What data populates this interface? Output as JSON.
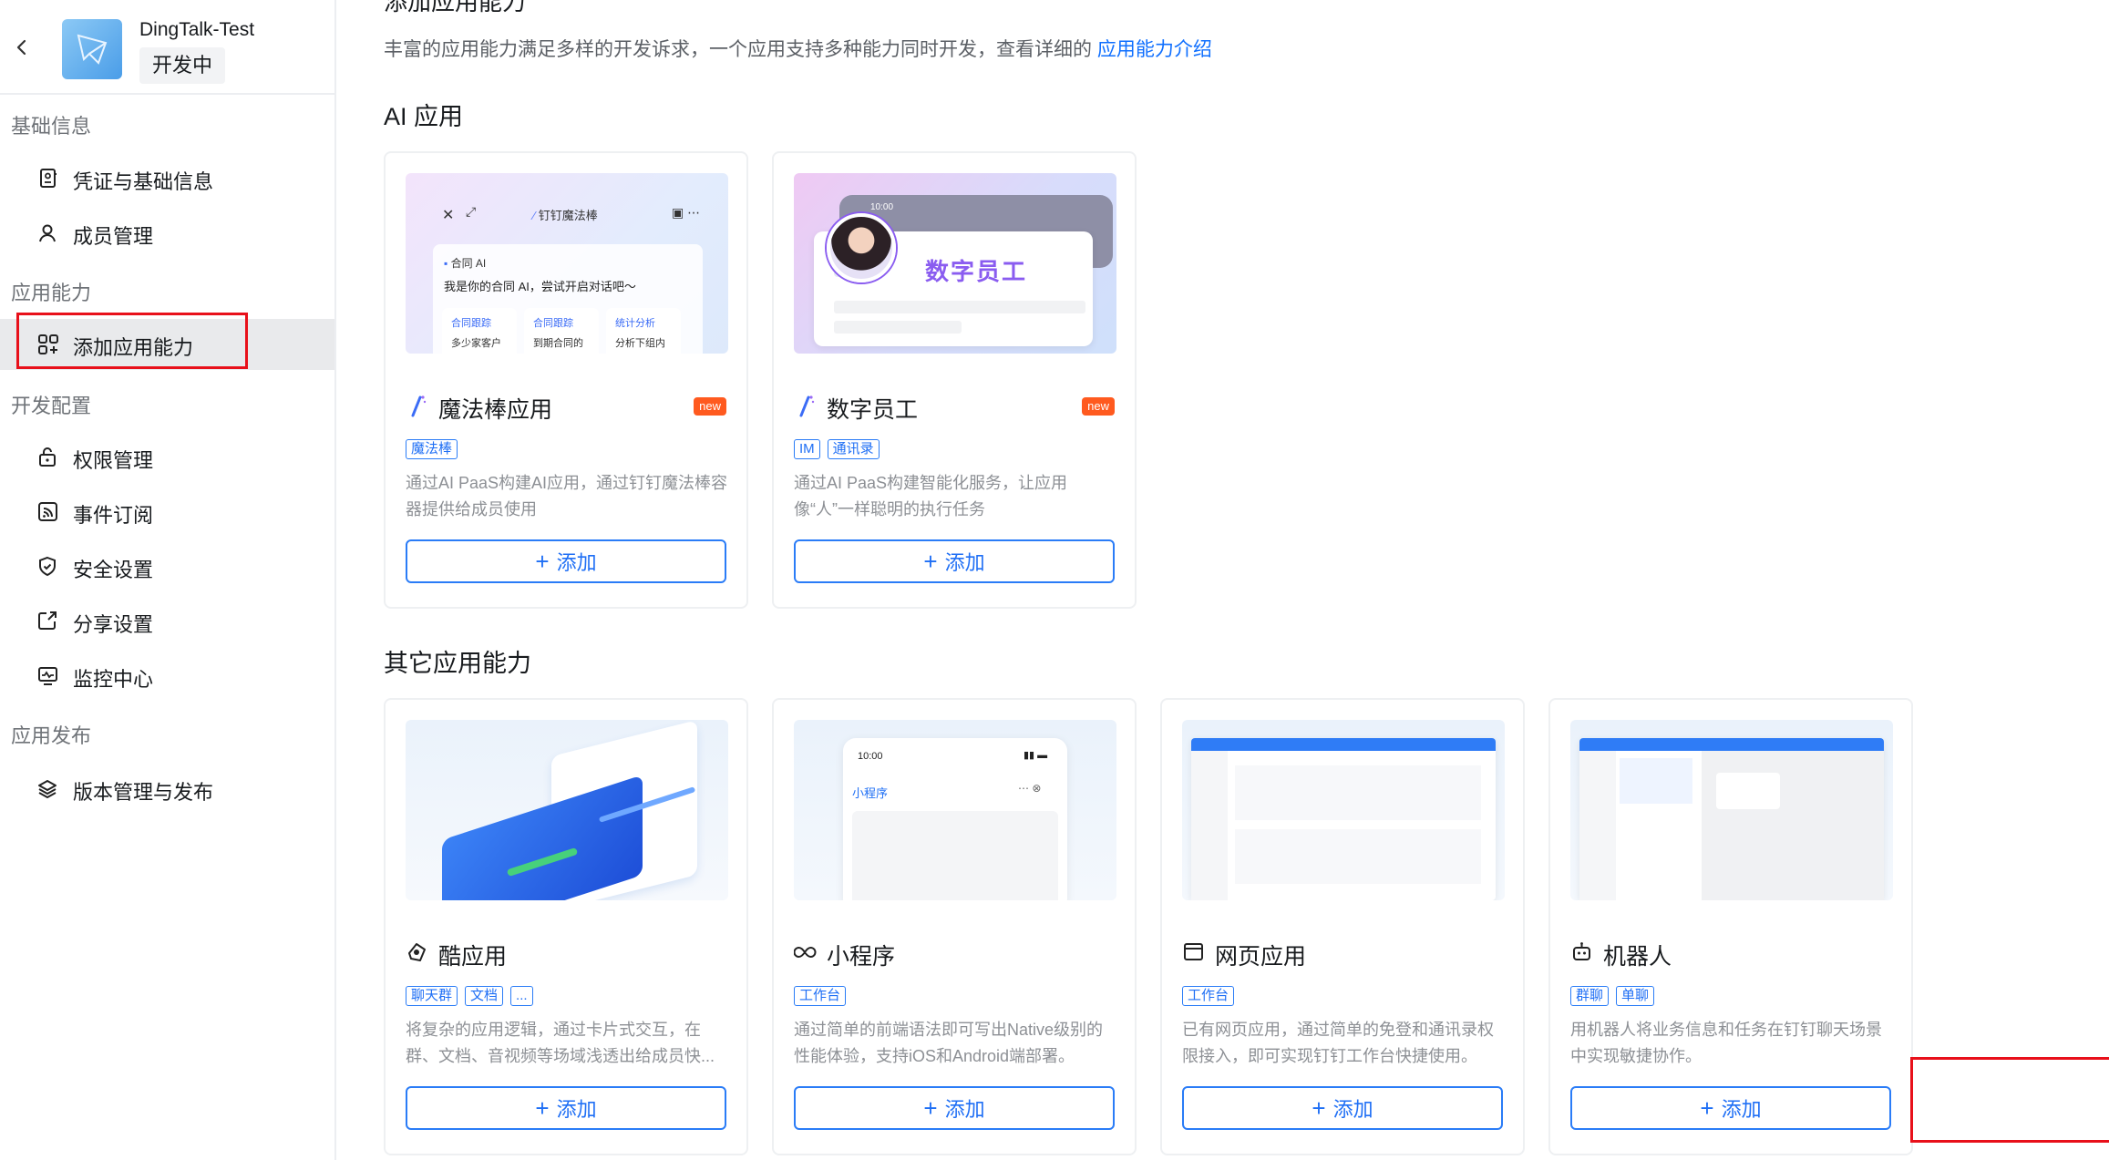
{
  "app": {
    "name": "DingTalk-Test",
    "status": "开发中"
  },
  "sidebar": {
    "groups": [
      {
        "title": "基础信息",
        "items": [
          {
            "label": "凭证与基础信息",
            "icon": "credential-icon"
          },
          {
            "label": "成员管理",
            "icon": "user-icon"
          }
        ]
      },
      {
        "title": "应用能力",
        "items": [
          {
            "label": "添加应用能力",
            "icon": "apps-add-icon",
            "active": true
          }
        ]
      },
      {
        "title": "开发配置",
        "items": [
          {
            "label": "权限管理",
            "icon": "lock-icon"
          },
          {
            "label": "事件订阅",
            "icon": "rss-icon"
          },
          {
            "label": "安全设置",
            "icon": "shield-icon"
          },
          {
            "label": "分享设置",
            "icon": "share-icon"
          },
          {
            "label": "监控中心",
            "icon": "monitor-icon"
          }
        ]
      },
      {
        "title": "应用发布",
        "items": [
          {
            "label": "版本管理与发布",
            "icon": "layers-icon"
          }
        ]
      }
    ]
  },
  "main": {
    "top_title": "添加应用能力",
    "intro_text": "丰富的应用能力满足多样的开发诉求，一个应用支持多种能力同时开发，查看详细的",
    "intro_link": "应用能力介绍",
    "ai_section_title": "AI 应用",
    "other_section_title": "其它应用能力",
    "add_label": "添加",
    "new_badge": "new",
    "ai_cards": [
      {
        "title": "魔法棒应用",
        "icon": "magic-wand-icon",
        "tags": [
          "魔法棒"
        ],
        "desc": "通过AI PaaS构建AI应用，通过钉钉魔法棒容器提供给成员使用",
        "thumb": {
          "header": "钉钉魔法棒",
          "label": "合同 AI",
          "greeting": "我是你的合同 AI，尝试开启对话吧～",
          "chips": [
            {
              "title": "合同跟踪",
              "sub": "多少家客户"
            },
            {
              "title": "合同跟踪",
              "sub": "到期合同的"
            },
            {
              "title": "统计分析",
              "sub": "分析下组内"
            }
          ]
        }
      },
      {
        "title": "数字员工",
        "icon": "magic-wand-icon",
        "tags": [
          "IM",
          "通讯录"
        ],
        "desc": "通过AI PaaS构建智能化服务，让应用像“人”一样聪明的执行任务",
        "thumb": {
          "time": "10:00",
          "label": "数字员工"
        }
      }
    ],
    "other_cards": [
      {
        "title": "酷应用",
        "icon": "cool-app-icon",
        "tags": [
          "聊天群",
          "文档",
          "..."
        ],
        "desc": "将复杂的应用逻辑，通过卡片式交互，在群、文档、音视频等场域浅透出给成员快..."
      },
      {
        "title": "小程序",
        "icon": "mini-program-icon",
        "tags": [
          "工作台"
        ],
        "desc": "通过简单的前端语法即可写出Native级别的性能体验，支持iOS和Android端部署。",
        "thumb": {
          "time": "10:00",
          "label": "小程序"
        }
      },
      {
        "title": "网页应用",
        "icon": "web-page-icon",
        "tags": [
          "工作台"
        ],
        "desc": "已有网页应用，通过简单的免登和通讯录权限接入，即可实现钉钉工作台快捷使用。"
      },
      {
        "title": "机器人",
        "icon": "robot-icon",
        "tags": [
          "群聊",
          "单聊"
        ],
        "desc": "用机器人将业务信息和任务在钉钉聊天场景中实现敏捷协作。"
      }
    ]
  },
  "colors": {
    "accent": "#1f6ff5",
    "highlight": "#e8101a",
    "new_badge": "#ff5a1f"
  }
}
